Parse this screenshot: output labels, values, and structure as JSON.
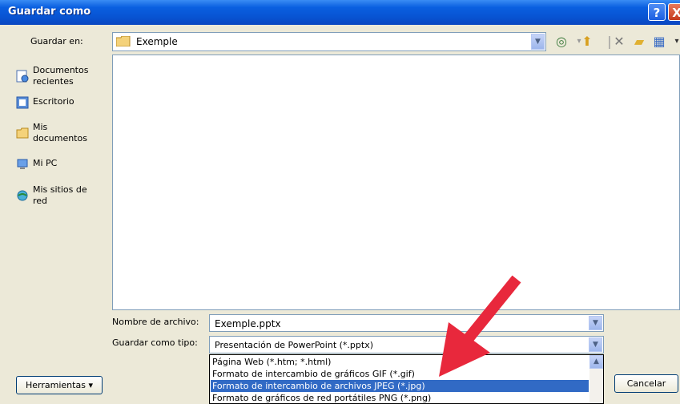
{
  "window": {
    "title": "Guardar como",
    "help_glyph": "?",
    "close_glyph": "X"
  },
  "savein": {
    "label": "Guardar en:",
    "value": "Exemple",
    "icon": "folder-icon"
  },
  "toolbar": {
    "back_icon": "back-icon",
    "up_icon": "up-folder-icon",
    "delete_icon": "delete-icon",
    "newfolder_icon": "new-folder-icon",
    "views_icon": "views-icon"
  },
  "places": [
    {
      "label": "Documentos recientes",
      "icon": "recent-documents-icon"
    },
    {
      "label": "Escritorio",
      "icon": "desktop-icon"
    },
    {
      "label": "Mis documentos",
      "icon": "my-documents-icon"
    },
    {
      "label": "Mi PC",
      "icon": "my-computer-icon"
    },
    {
      "label": "Mis sitios de red",
      "icon": "network-places-icon"
    }
  ],
  "filename": {
    "label": "Nombre de archivo:",
    "value": "Exemple.pptx"
  },
  "filetype": {
    "label": "Guardar como tipo:",
    "value": "Presentación de PowerPoint (*.pptx)",
    "options": [
      "Página Web (*.htm; *.html)",
      "Formato de intercambio de gráficos GIF (*.gif)",
      "Formato de intercambio de archivos JPEG (*.jpg)",
      "Formato de gráficos de red portátiles PNG (*.png)"
    ],
    "selected_index": 2
  },
  "buttons": {
    "tools": "Herramientas",
    "cancel": "Cancelar"
  },
  "colors": {
    "title_bar": "#0853d2",
    "selection": "#316ac5",
    "arrow": "#e8283c"
  }
}
